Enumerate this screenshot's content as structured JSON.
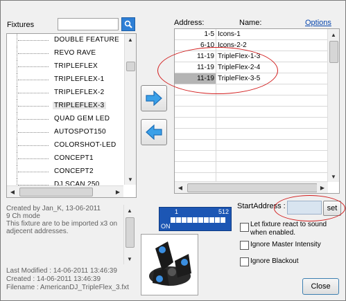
{
  "fixtures": {
    "label": "Fixtures",
    "search": {
      "value": "",
      "icon": "search-icon"
    },
    "items": [
      {
        "label": "DOUBLE FEATURE"
      },
      {
        "label": "REVO RAVE"
      },
      {
        "label": "TRIPLEFLEX"
      },
      {
        "label": "TRIPLEFLEX-1"
      },
      {
        "label": "TRIPLEFLEX-2"
      },
      {
        "label": "TRIPLEFLEX-3",
        "selected": true
      },
      {
        "label": "QUAD GEM LED"
      },
      {
        "label": "AUTOSPOT150"
      },
      {
        "label": "COLORSHOT-LED"
      },
      {
        "label": "CONCEPT1"
      },
      {
        "label": "CONCEPT2"
      },
      {
        "label": "DJ SCAN 250"
      }
    ]
  },
  "info": {
    "lines": [
      "Created by Jan_K, 13-06-2011",
      "9 Ch mode",
      "This fixture are to be imported x3 on adjecent addresses."
    ],
    "last_modified": "Last Modified : 14-06-2011 13:46:39",
    "created": "Created : 14-06-2011 13:46:39",
    "filename": "Filename : AmericanDJ_TripleFlex_3.fxt"
  },
  "address_table": {
    "address_header": "Address:",
    "name_header": "Name:",
    "options_link": "Options",
    "rows": [
      {
        "address": "1-5",
        "name": "Icons-1"
      },
      {
        "address": "6-10",
        "name": "Icons-2-2"
      },
      {
        "address": "11-19",
        "name": "TripleFlex-1-3"
      },
      {
        "address": "11-19",
        "name": "TripleFlex-2-4"
      },
      {
        "address": "11-19",
        "name": "TripleFlex-3-5",
        "selected": true
      }
    ]
  },
  "dmx": {
    "start": "1",
    "end": "512",
    "state": "ON"
  },
  "start_address": {
    "label": "StartAddress :",
    "value": "",
    "set_label": "set"
  },
  "options": [
    {
      "label": "Let fixture react to sound when enabled.",
      "checked": false
    },
    {
      "label": "Ignore Master Intensity",
      "checked": false
    },
    {
      "label": "Ignore Blackout",
      "checked": false
    }
  ],
  "close_label": "Close",
  "colors": {
    "accent": "#1c56b4",
    "annotation": "#d21c1c",
    "link": "#0645ad"
  }
}
